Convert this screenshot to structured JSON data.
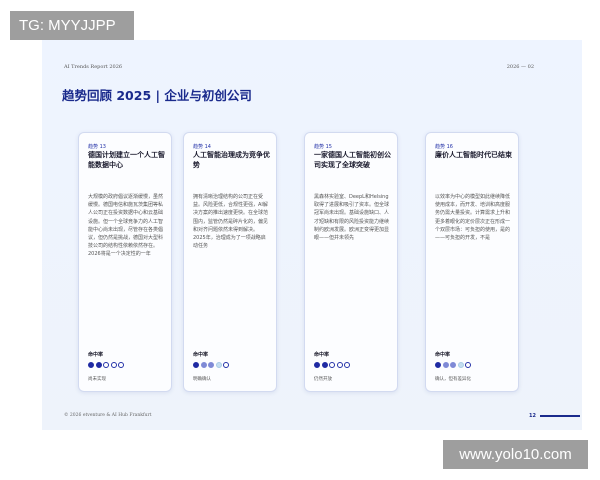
{
  "watermark": {
    "top": "TG: MYYJJPP",
    "bottom": "www.yolo10.com"
  },
  "report": {
    "name": "AI Trends Report 2026",
    "page_tag": "2026 — 02"
  },
  "title": "趋势回顾 2025 | 企业与初创公司",
  "cards": [
    {
      "tag": "趋势 13",
      "heading": "德国计划建立一个人工智能数据中心",
      "body": "大规模的政府倡议逐渐缓慢，虽然缓慢。德国电信和施瓦茨集团等私人公司正在投资数据中心和云基础设施。但一个全球竞争力的人工智能中心尚未出现，尽管存在各类倡议，但仍然是挑战，德国对大型科技公司的结构性依赖依然存在。2026将是一个决定性的一年",
      "maturity_label": "命中率",
      "maturity_level": 2,
      "caption": "尚未实现"
    },
    {
      "tag": "趋势 14",
      "heading": "人工智能治理成为竞争优势",
      "body": "拥有清晰治理结构的公司正在受益。风险更低，合规性更强，AI解决方案的推出速度更快。在全球范围内，监管仍然是碎片化的，偏见和对齐问题依然未得到解决。2025年，治理成为了一项战略启动任务",
      "maturity_label": "命中率",
      "maturity_level": 3,
      "caption": "明确确认"
    },
    {
      "tag": "趋势 15",
      "heading": "一家德国人工智能初创公司实现了全球突破",
      "body": "黑森林实验室、DeepL和Helsing取得了进展和吸引了资本。但全球冠军尚未出现。基础设施缺口、人才短缺和有限的风险投资能力继续制约欧洲发展。欧洲正变得更加显眼——但并未领先",
      "maturity_label": "命中率",
      "maturity_level": 2,
      "caption": "仍然开放"
    },
    {
      "tag": "趋势 16",
      "heading": "廉价人工智能时代已结束",
      "body": "以效率为中心的模型如此继续降低使用成本，而开发、培训和高度服务仍需大量投资。计算需求上升和更多着眼化的定价层次正在形成一个双层市场：可负担的使用，是的——可负担的开发，不是",
      "maturity_label": "命中率",
      "maturity_level": 3,
      "caption": "确认，但有差异化"
    }
  ],
  "footer": {
    "copyright": "© 2026 etventure & AI Hub Frankfurt",
    "page_number": "12"
  },
  "colors": {
    "accent": "#1a2a8c",
    "dot_filled": "#1f2aa3",
    "dot_mid": "#7f8ad6",
    "dot_light": "#c4def0"
  }
}
